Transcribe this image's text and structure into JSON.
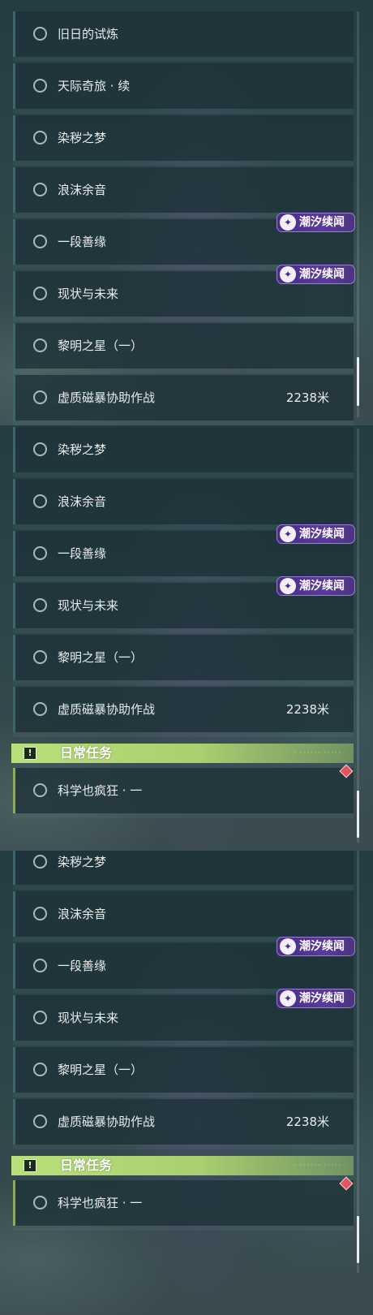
{
  "panels": [
    {
      "quests": [
        {
          "label": "旧日的试炼",
          "distance": ""
        },
        {
          "label": "天际奇旅 · 续",
          "distance": ""
        },
        {
          "label": "染秽之梦",
          "distance": ""
        },
        {
          "label": "浪沫余音",
          "distance": ""
        },
        {
          "label": "一段善缘",
          "distance": ""
        },
        {
          "label": "现状与未来",
          "distance": ""
        },
        {
          "label": "黎明之星（一）",
          "distance": ""
        },
        {
          "label": "虚质磁暴协助作战",
          "distance": "2238米"
        }
      ],
      "badges": [
        "潮汐续闻",
        "潮汐续闻"
      ]
    },
    {
      "quests": [
        {
          "label": "染秽之梦",
          "distance": ""
        },
        {
          "label": "浪沫余音",
          "distance": ""
        },
        {
          "label": "一段善缘",
          "distance": ""
        },
        {
          "label": "现状与未来",
          "distance": ""
        },
        {
          "label": "黎明之星（一）",
          "distance": ""
        },
        {
          "label": "虚质磁暴协助作战",
          "distance": "2238米"
        }
      ],
      "badges": [
        "潮汐续闻",
        "潮汐续闻"
      ],
      "daily_section": {
        "title": "日常任务",
        "quest": "科学也疯狂 · 一"
      }
    },
    {
      "quests": [
        {
          "label": "染秽之梦",
          "distance": ""
        },
        {
          "label": "浪沫余音",
          "distance": ""
        },
        {
          "label": "一段善缘",
          "distance": ""
        },
        {
          "label": "现状与未来",
          "distance": ""
        },
        {
          "label": "黎明之星（一）",
          "distance": ""
        },
        {
          "label": "虚质磁暴协助作战",
          "distance": "2238米"
        }
      ],
      "badges": [
        "潮汐续闻",
        "潮汐续闻"
      ],
      "daily_section": {
        "title": "日常任务",
        "quest": "科学也疯狂 · 一"
      }
    }
  ],
  "icons": {
    "quest_status": "circle-outline-icon",
    "badge": "tide-story-icon",
    "daily_header": "exclamation-box-icon",
    "daily_marker": "red-diamond-icon"
  },
  "colors": {
    "badge_purple": "#5a3a9a",
    "daily_green": "#b9e07a",
    "marker_red": "#e05560"
  }
}
